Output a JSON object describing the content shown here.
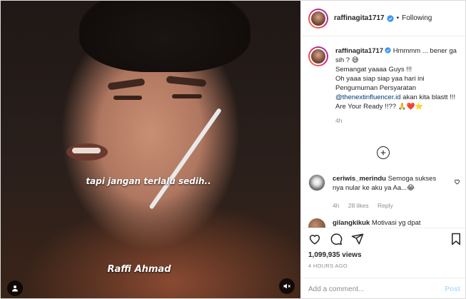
{
  "post": {
    "username": "raffinagita1717",
    "separator": "•",
    "follow_status": "Following",
    "verified": true
  },
  "media": {
    "caption_top": "tapi jangan terlalu sedih..",
    "caption_bottom": "Raffi Ahmad",
    "icons": [
      "person-tag-icon",
      "mute-icon"
    ]
  },
  "caption": {
    "username": "raffinagita1717",
    "line1": " Hmmmm ... bener ga sih ? 😅",
    "line2": "Semangat yaaaa Guys !!!",
    "line3": "Oh yaaa siap siap yaa hari ini Pengumuman Persyaratan",
    "mention": "@thenextinfluencer.id",
    "line3b": " akan kita blastt !!!",
    "line4": "Are Your Ready !!?? 🙏❤️⭐",
    "time": "4h"
  },
  "comments": [
    {
      "username": "ceriwis_merindu",
      "text": " Semoga sukses nya nular ke aku ya Aa...😂",
      "time": "4h",
      "likes": "28 likes",
      "reply": "Reply"
    },
    {
      "username": "gilangkikuk",
      "text": " Motivasi yg dpat"
    }
  ],
  "actions": {
    "icons": [
      "heart-icon",
      "comment-icon",
      "share-icon",
      "bookmark-icon"
    ],
    "views": "1,099,935 views",
    "time_ago": "4 HOURS AGO"
  },
  "add_comment": {
    "placeholder": "Add a comment...",
    "post_label": "Post"
  },
  "colors": {
    "link": "#00376b",
    "verified": "#3897f0",
    "muted": "#8e8e8e",
    "post_disabled": "#b2dffc"
  }
}
